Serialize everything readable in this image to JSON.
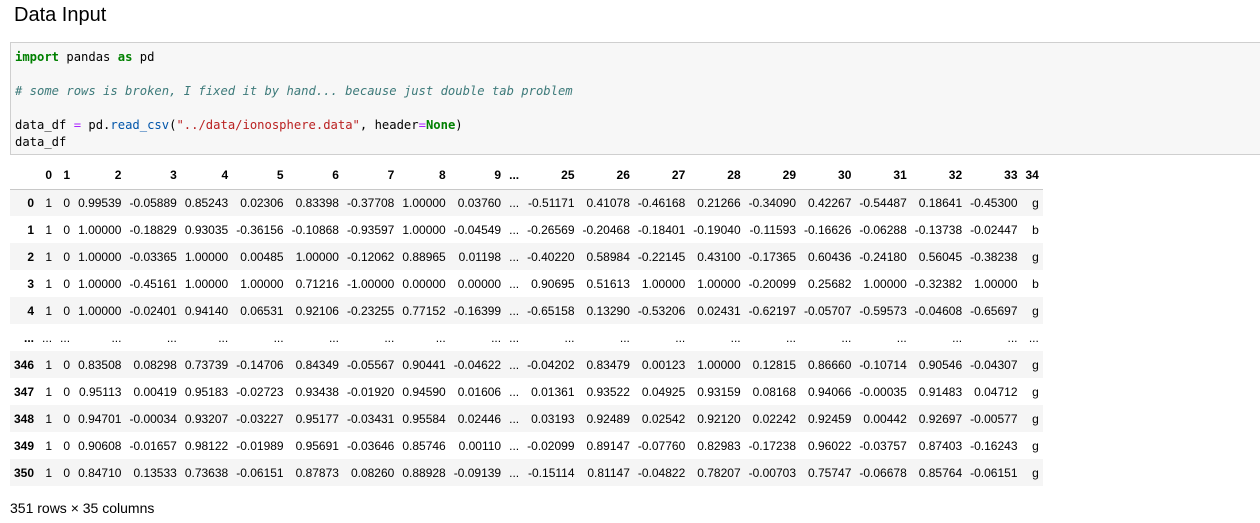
{
  "title": "Data Input",
  "code": {
    "line1": {
      "kw1": "import",
      "mod": " pandas ",
      "kw2": "as",
      "alias": " pd"
    },
    "line2": "# some rows is broken, I fixed it by hand... because just double tab problem",
    "line3": {
      "var": "data_df ",
      "eq": "=",
      "obj": " pd.",
      "fn": "read_csv",
      "paren": "(",
      "str": "\"../data/ionosphere.data\"",
      "comma": ", header",
      "eq2": "=",
      "none": "None",
      "close": ")"
    },
    "line4": "data_df"
  },
  "table": {
    "columns": [
      "",
      "0",
      "1",
      "2",
      "3",
      "4",
      "5",
      "6",
      "7",
      "8",
      "9",
      "...",
      "25",
      "26",
      "27",
      "28",
      "29",
      "30",
      "31",
      "32",
      "33",
      "34"
    ],
    "rows": [
      [
        "0",
        "1",
        "0",
        "0.99539",
        "-0.05889",
        "0.85243",
        "0.02306",
        "0.83398",
        "-0.37708",
        "1.00000",
        "0.03760",
        "...",
        "-0.51171",
        "0.41078",
        "-0.46168",
        "0.21266",
        "-0.34090",
        "0.42267",
        "-0.54487",
        "0.18641",
        "-0.45300",
        "g"
      ],
      [
        "1",
        "1",
        "0",
        "1.00000",
        "-0.18829",
        "0.93035",
        "-0.36156",
        "-0.10868",
        "-0.93597",
        "1.00000",
        "-0.04549",
        "...",
        "-0.26569",
        "-0.20468",
        "-0.18401",
        "-0.19040",
        "-0.11593",
        "-0.16626",
        "-0.06288",
        "-0.13738",
        "-0.02447",
        "b"
      ],
      [
        "2",
        "1",
        "0",
        "1.00000",
        "-0.03365",
        "1.00000",
        "0.00485",
        "1.00000",
        "-0.12062",
        "0.88965",
        "0.01198",
        "...",
        "-0.40220",
        "0.58984",
        "-0.22145",
        "0.43100",
        "-0.17365",
        "0.60436",
        "-0.24180",
        "0.56045",
        "-0.38238",
        "g"
      ],
      [
        "3",
        "1",
        "0",
        "1.00000",
        "-0.45161",
        "1.00000",
        "1.00000",
        "0.71216",
        "-1.00000",
        "0.00000",
        "0.00000",
        "...",
        "0.90695",
        "0.51613",
        "1.00000",
        "1.00000",
        "-0.20099",
        "0.25682",
        "1.00000",
        "-0.32382",
        "1.00000",
        "b"
      ],
      [
        "4",
        "1",
        "0",
        "1.00000",
        "-0.02401",
        "0.94140",
        "0.06531",
        "0.92106",
        "-0.23255",
        "0.77152",
        "-0.16399",
        "...",
        "-0.65158",
        "0.13290",
        "-0.53206",
        "0.02431",
        "-0.62197",
        "-0.05707",
        "-0.59573",
        "-0.04608",
        "-0.65697",
        "g"
      ],
      [
        "...",
        "...",
        "...",
        "...",
        "...",
        "...",
        "...",
        "...",
        "...",
        "...",
        "...",
        "...",
        "...",
        "...",
        "...",
        "...",
        "...",
        "...",
        "...",
        "...",
        "...",
        "..."
      ],
      [
        "346",
        "1",
        "0",
        "0.83508",
        "0.08298",
        "0.73739",
        "-0.14706",
        "0.84349",
        "-0.05567",
        "0.90441",
        "-0.04622",
        "...",
        "-0.04202",
        "0.83479",
        "0.00123",
        "1.00000",
        "0.12815",
        "0.86660",
        "-0.10714",
        "0.90546",
        "-0.04307",
        "g"
      ],
      [
        "347",
        "1",
        "0",
        "0.95113",
        "0.00419",
        "0.95183",
        "-0.02723",
        "0.93438",
        "-0.01920",
        "0.94590",
        "0.01606",
        "...",
        "0.01361",
        "0.93522",
        "0.04925",
        "0.93159",
        "0.08168",
        "0.94066",
        "-0.00035",
        "0.91483",
        "0.04712",
        "g"
      ],
      [
        "348",
        "1",
        "0",
        "0.94701",
        "-0.00034",
        "0.93207",
        "-0.03227",
        "0.95177",
        "-0.03431",
        "0.95584",
        "0.02446",
        "...",
        "0.03193",
        "0.92489",
        "0.02542",
        "0.92120",
        "0.02242",
        "0.92459",
        "0.00442",
        "0.92697",
        "-0.00577",
        "g"
      ],
      [
        "349",
        "1",
        "0",
        "0.90608",
        "-0.01657",
        "0.98122",
        "-0.01989",
        "0.95691",
        "-0.03646",
        "0.85746",
        "0.00110",
        "...",
        "-0.02099",
        "0.89147",
        "-0.07760",
        "0.82983",
        "-0.17238",
        "0.96022",
        "-0.03757",
        "0.87403",
        "-0.16243",
        "g"
      ],
      [
        "350",
        "1",
        "0",
        "0.84710",
        "0.13533",
        "0.73638",
        "-0.06151",
        "0.87873",
        "0.08260",
        "0.88928",
        "-0.09139",
        "...",
        "-0.15114",
        "0.81147",
        "-0.04822",
        "0.78207",
        "-0.00703",
        "0.75747",
        "-0.06678",
        "0.85764",
        "-0.06151",
        "g"
      ]
    ]
  },
  "footer": "351 rows × 35 columns"
}
